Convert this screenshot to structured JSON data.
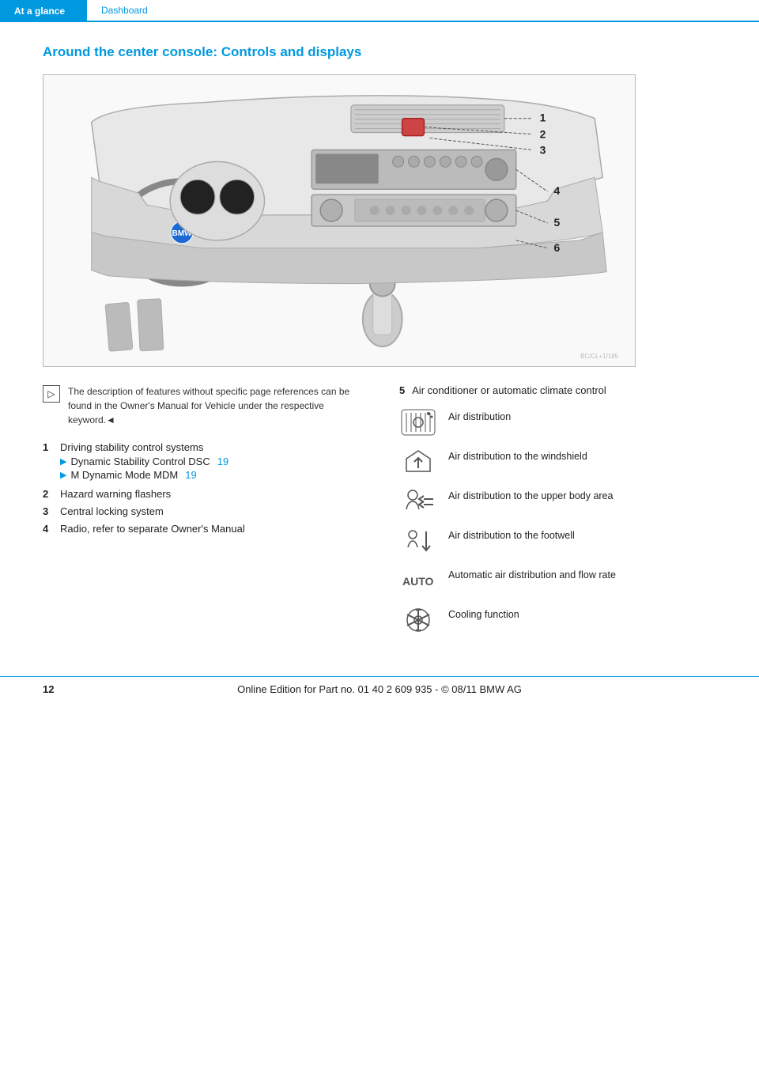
{
  "header": {
    "section": "At a glance",
    "subsection": "Dashboard"
  },
  "page_title": "Around the center console: Controls and displays",
  "diagram": {
    "label_1": "1",
    "label_2": "2",
    "label_3": "3",
    "label_4": "4",
    "label_5": "5",
    "label_6": "6"
  },
  "notice": {
    "icon": "▷",
    "text": "The description of features without specific page references can be found in the Owner's Manual for Vehicle under the respective keyword.◄"
  },
  "left_list": {
    "items": [
      {
        "num": "1",
        "label": "Driving stability control systems",
        "sub": [
          {
            "text": "Dynamic Stability Control DSC",
            "ref": "19"
          },
          {
            "text": "M Dynamic Mode MDM",
            "ref": "19"
          }
        ]
      },
      {
        "num": "2",
        "label": "Hazard warning flashers",
        "sub": []
      },
      {
        "num": "3",
        "label": "Central locking system",
        "sub": []
      },
      {
        "num": "4",
        "label": "Radio, refer to separate Owner's Manual",
        "sub": []
      }
    ]
  },
  "right_section": {
    "item_num": "5",
    "item_label": "Air conditioner or automatic climate control",
    "icon_rows": [
      {
        "icon_type": "air-distribution",
        "icon_text": "❄✦",
        "label": "Air distribution"
      },
      {
        "icon_type": "air-windshield",
        "icon_text": "⬆",
        "label": "Air distribution to the windshield"
      },
      {
        "icon_type": "air-upper-body",
        "icon_text": "➡",
        "label": "Air distribution to the upper body area"
      },
      {
        "icon_type": "air-footwell",
        "icon_text": "⬇",
        "label": "Air distribution to the footwell"
      },
      {
        "icon_type": "auto",
        "icon_text": "AUTO",
        "label": "Automatic air distribution and flow rate"
      },
      {
        "icon_type": "cooling",
        "icon_text": "✳",
        "label": "Cooling function"
      }
    ]
  },
  "footer": {
    "page_num": "12",
    "copyright": "Online Edition for Part no. 01 40 2 609 935 - © 08/11 BMW AG"
  }
}
